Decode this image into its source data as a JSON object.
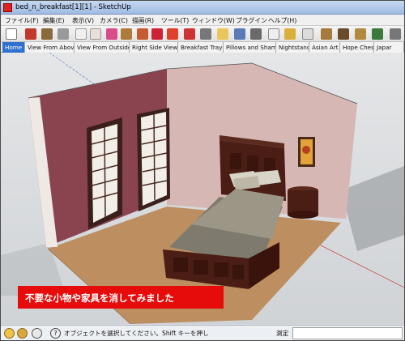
{
  "window": {
    "title": "bed_n_breakfast[1][1] - SketchUp"
  },
  "menu": [
    "ファイル(F)",
    "編集(E)",
    "表示(V)",
    "カメラ(C)",
    "描画(R)",
    "ツール(T)",
    "ウィンドウ(W)",
    "プラグイン",
    "ヘルプ(H)"
  ],
  "toolbar": {
    "icons": [
      "select-tool-icon",
      "pencil-line-icon",
      "rectangle-icon",
      "arc-icon",
      "eraser-icon",
      "paint-bucket-icon",
      "push-pull-icon",
      "move-icon",
      "rotate-icon",
      "offset-icon",
      "orbit-icon",
      "pan-icon",
      "zoom-icon",
      "zoom-extents-icon",
      "tape-measure-icon",
      "dimension-icon",
      "text-icon",
      "walk-icon",
      "position-camera-icon",
      "look-around-icon",
      "section-plane-icon",
      "components-icon"
    ]
  },
  "tabs": [
    "Home",
    "View From Above",
    "View From Outside",
    "Right Side View",
    "Breakfast Tray",
    "Pillows and Shams",
    "Nightstand",
    "Asian Art",
    "Hope Chest",
    "Japar"
  ],
  "caption": "不要な小物や家具を消してみました",
  "status": {
    "message": "オブジェクトを選択してください。Shift キーを押し",
    "measure_label": "測定"
  },
  "colors": {
    "accent": "#e60c0c",
    "active_tab": "#2f6fd0"
  }
}
